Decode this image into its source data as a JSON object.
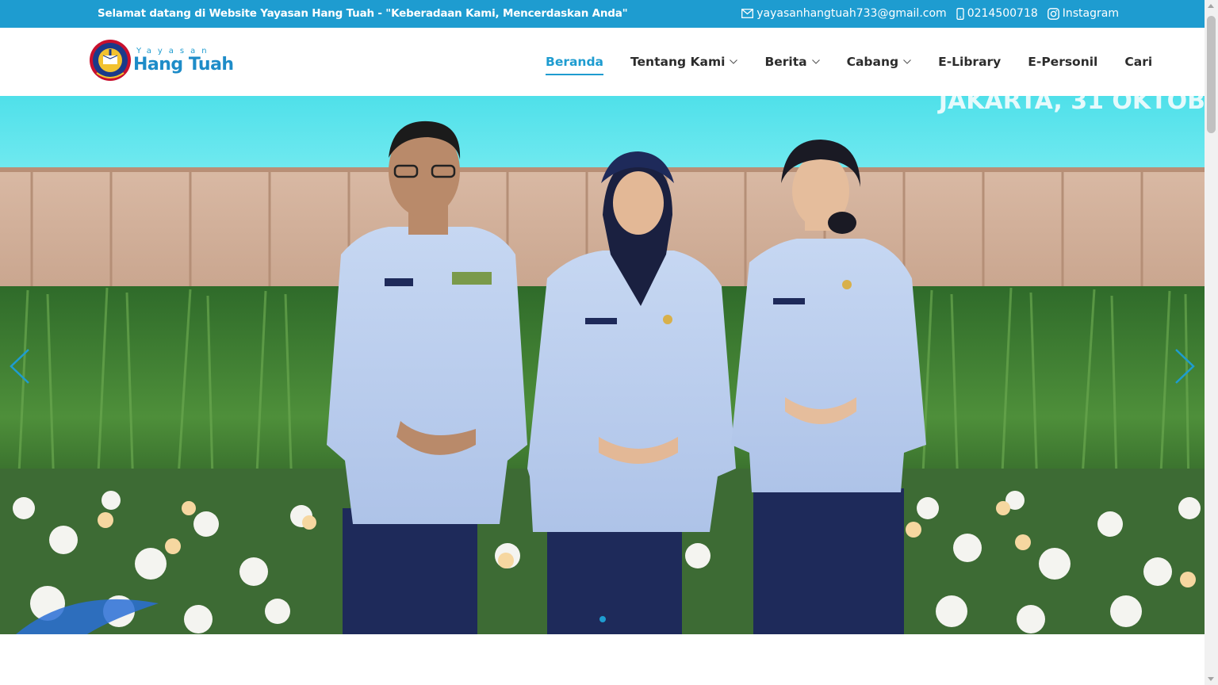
{
  "topbar": {
    "welcome": "Selamat datang di Website Yayasan Hang Tuah - \"Keberadaan Kami, Mencerdaskan Anda\"",
    "email": "yayasanhangtuah733@gmail.com",
    "phone": "0214500718",
    "social": "Instagram",
    "bg_color": "#1e9cd0"
  },
  "logo": {
    "small_text": "Yayasan",
    "big_text": "Hang Tuah"
  },
  "nav": {
    "items": [
      {
        "label": "Beranda",
        "active": true,
        "dropdown": false
      },
      {
        "label": "Tentang Kami",
        "active": false,
        "dropdown": true
      },
      {
        "label": "Berita",
        "active": false,
        "dropdown": true
      },
      {
        "label": "Cabang",
        "active": false,
        "dropdown": true
      },
      {
        "label": "E-Library",
        "active": false,
        "dropdown": false
      },
      {
        "label": "E-Personil",
        "active": false,
        "dropdown": false
      },
      {
        "label": "Cari",
        "active": false,
        "dropdown": false
      }
    ],
    "accent_color": "#1e9cd0"
  },
  "hero": {
    "banner_text": "JAKARTA, 31 OKTOB",
    "slide_count": 1,
    "active_slide": 0
  },
  "icons": {
    "email": "envelope-icon",
    "phone": "mobile-phone-icon",
    "social": "instagram-icon",
    "prev": "chevron-left-icon",
    "next": "chevron-right-icon"
  }
}
